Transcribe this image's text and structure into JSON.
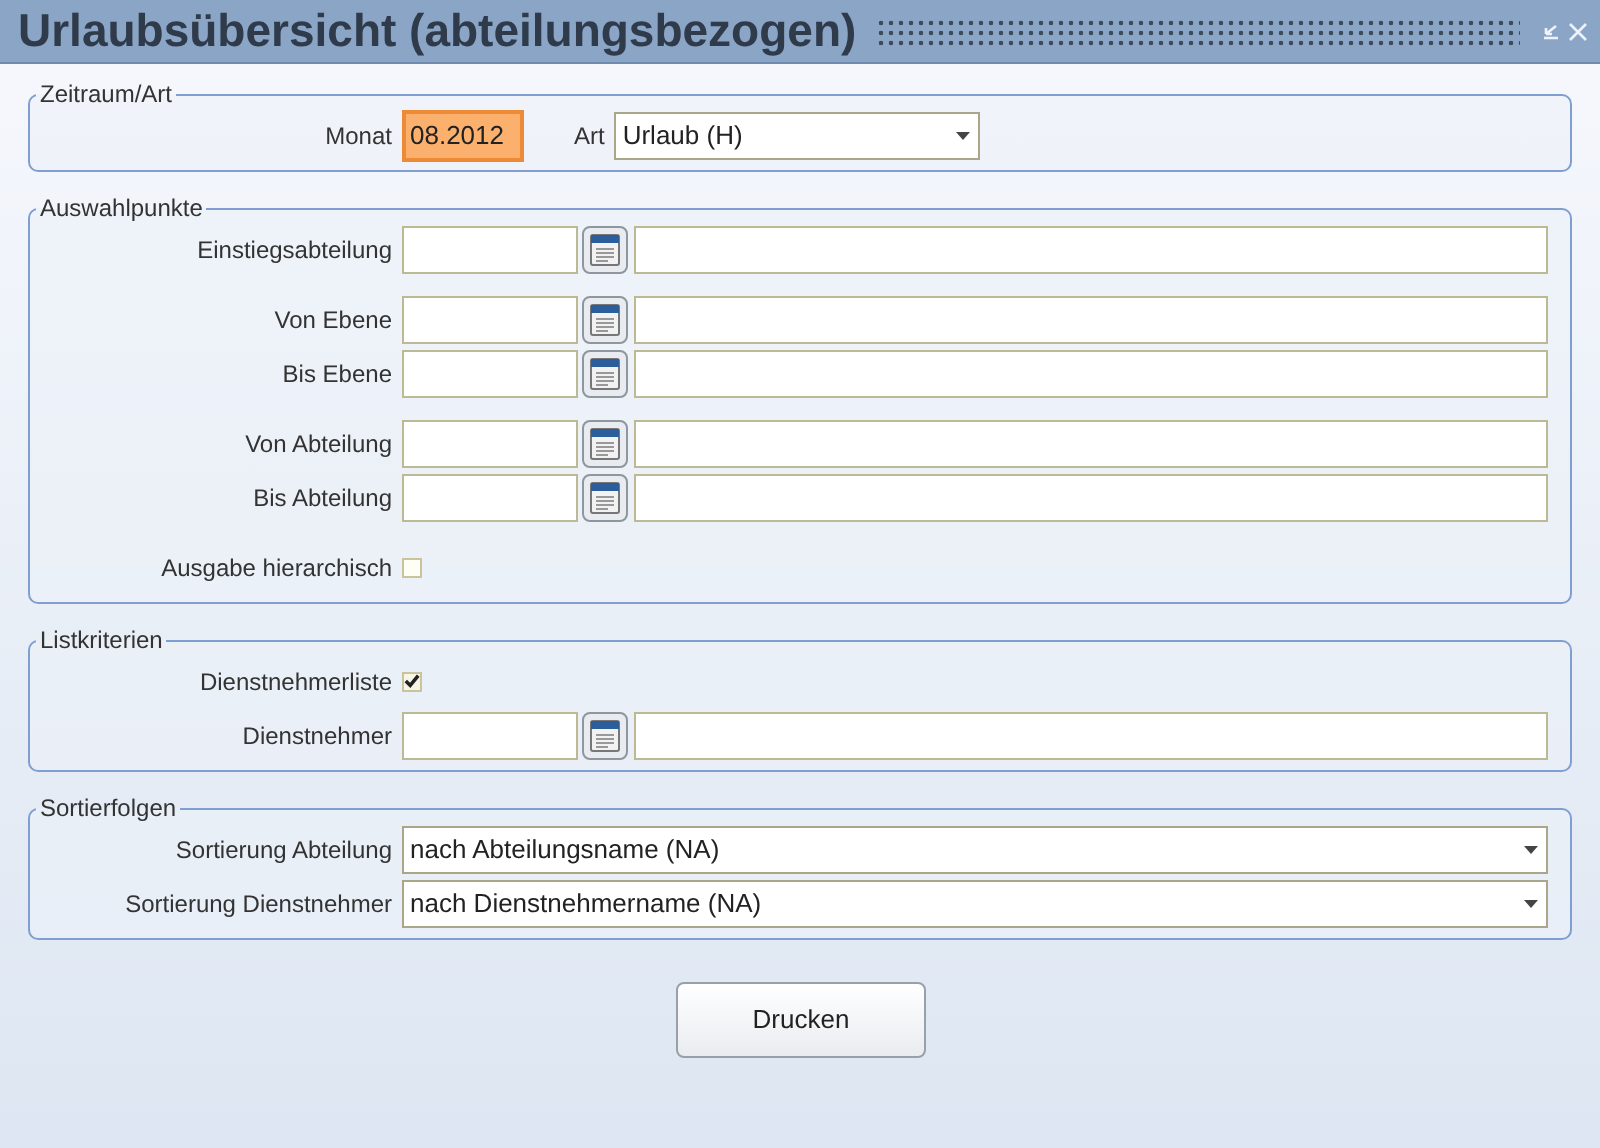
{
  "window": {
    "title": "Urlaubsübersicht (abteilungsbezogen)"
  },
  "sections": [
    {
      "legend": "Zeitraum/Art",
      "blocks": [
        [
          {
            "kind": "period",
            "label": "Monat",
            "value": "08.2012",
            "type_label": "Art",
            "type_value": "Urlaub (H)"
          }
        ]
      ]
    },
    {
      "legend": "Auswahlpunkte",
      "blocks": [
        [
          {
            "kind": "lookup",
            "label": "Einstiegsabteilung"
          }
        ],
        [
          {
            "kind": "lookup",
            "label": "Von Ebene"
          },
          {
            "kind": "lookup",
            "label": "Bis Ebene"
          }
        ],
        [
          {
            "kind": "lookup",
            "label": "Von Abteilung"
          },
          {
            "kind": "lookup",
            "label": "Bis Abteilung"
          }
        ],
        [
          {
            "kind": "checkbox",
            "label": "Ausgabe hierarchisch",
            "checked": false
          }
        ]
      ]
    },
    {
      "legend": "Listkriterien",
      "blocks": [
        [
          {
            "kind": "checkbox",
            "label": "Dienstnehmerliste",
            "checked": true
          },
          {
            "kind": "lookup",
            "label": "Dienstnehmer"
          }
        ]
      ]
    },
    {
      "legend": "Sortierfolgen",
      "blocks": [
        [
          {
            "kind": "select",
            "label": "Sortierung Abteilung",
            "value": "nach Abteilungsname (NA)"
          },
          {
            "kind": "select",
            "label": "Sortierung Dienstnehmer",
            "value": "nach Dienstnehmername (NA)"
          }
        ]
      ]
    }
  ],
  "print_button": "Drucken"
}
